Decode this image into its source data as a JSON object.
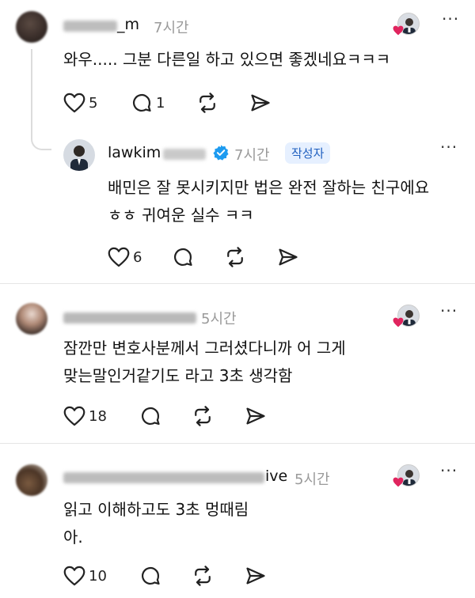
{
  "comments": [
    {
      "username_visible": "_m",
      "time": "7시간",
      "lines": [
        "와우..... 그분 다른일 하고 있으면 좋겠네요ㅋㅋㅋ"
      ],
      "like_count": "5",
      "reply_count": "1"
    },
    {
      "username_visible": "lawkim",
      "time": "7시간",
      "author_badge": "작성자",
      "lines": [
        "배민은 잘 못시키지만 법은 완전 잘하는 친구에요",
        "ㅎㅎ 귀여운 실수 ㅋㅋ"
      ],
      "like_count": "6"
    },
    {
      "time": "5시간",
      "lines": [
        "잠깐만 변호사분께서 그러셨다니까 어 그게",
        "맞는말인거같기도 라고 3초 생각함"
      ],
      "like_count": "18"
    },
    {
      "username_visible": "ive",
      "time": "5시간",
      "lines": [
        "읽고 이해하고도 3초 멍때림",
        "아."
      ],
      "like_count": "10"
    }
  ],
  "icons": {
    "heart": "heart-icon",
    "comment": "comment-icon",
    "repost": "repost-icon",
    "share": "send-icon",
    "more": "more-icon",
    "verified": "verified-badge-icon"
  },
  "colors": {
    "verified": "#1d9bf0",
    "liked_heart": "#e0245e",
    "muted_text": "#9a9a9a",
    "badge_bg": "#e6f0ff",
    "badge_text": "#1f5fbf"
  }
}
